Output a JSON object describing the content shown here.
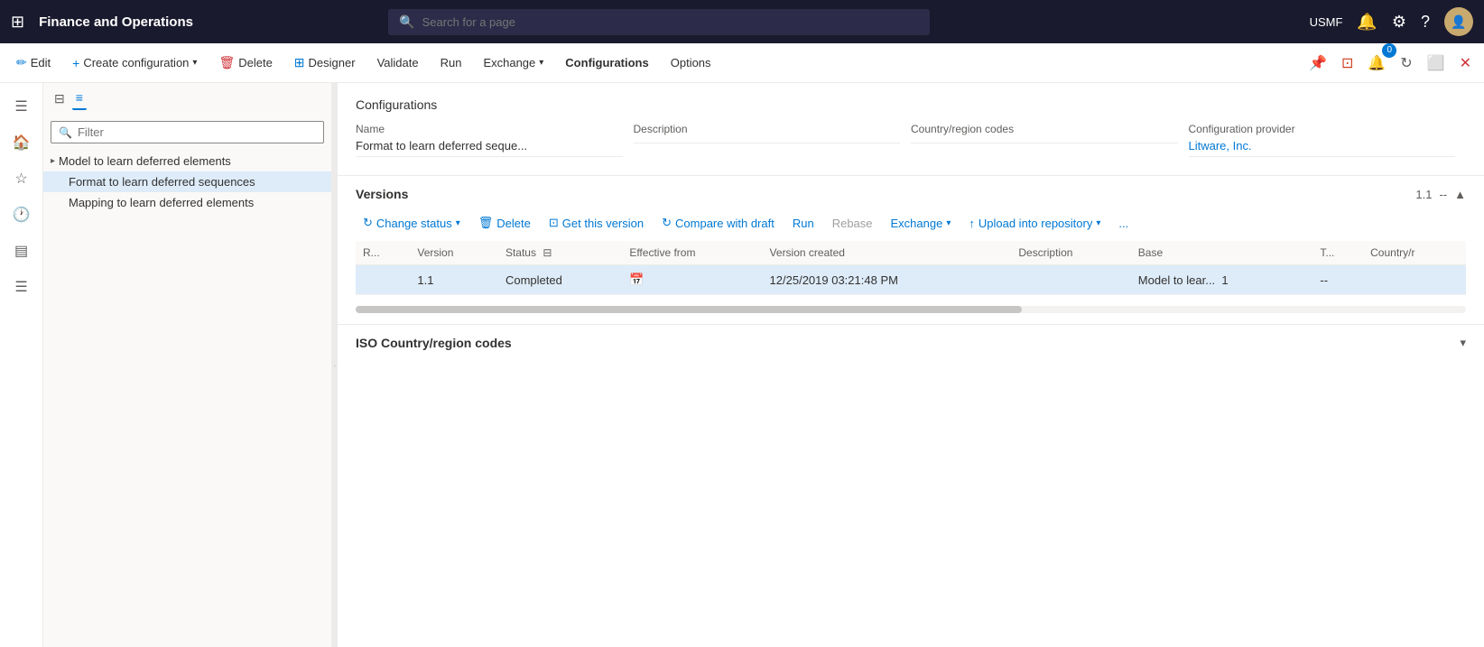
{
  "app": {
    "title": "Finance and Operations",
    "user": "USMF",
    "search_placeholder": "Search for a page",
    "notification_count": "0"
  },
  "command_bar": {
    "edit_label": "Edit",
    "create_config_label": "Create configuration",
    "delete_label": "Delete",
    "designer_label": "Designer",
    "validate_label": "Validate",
    "run_label": "Run",
    "exchange_label": "Exchange",
    "configurations_label": "Configurations",
    "options_label": "Options"
  },
  "tree": {
    "filter_placeholder": "Filter",
    "root_item": "Model to learn deferred elements",
    "items": [
      {
        "label": "Format to learn deferred sequences",
        "selected": true
      },
      {
        "label": "Mapping to learn deferred elements",
        "selected": false
      }
    ]
  },
  "config_panel": {
    "section_title": "Configurations",
    "fields": {
      "name_label": "Name",
      "name_value": "Format to learn deferred seque...",
      "description_label": "Description",
      "description_value": "",
      "country_label": "Country/region codes",
      "country_value": "",
      "provider_label": "Configuration provider",
      "provider_value": "Litware, Inc."
    }
  },
  "versions": {
    "title": "Versions",
    "version_number": "1.1",
    "separator": "--",
    "toolbar": {
      "change_status_label": "Change status",
      "delete_label": "Delete",
      "get_this_version_label": "Get this version",
      "compare_with_draft_label": "Compare with draft",
      "run_label": "Run",
      "rebase_label": "Rebase",
      "exchange_label": "Exchange",
      "upload_label": "Upload into repository",
      "more_label": "..."
    },
    "table": {
      "columns": [
        "R...",
        "Version",
        "Status",
        "Effective from",
        "Version created",
        "Description",
        "Base",
        "T...",
        "Country/r"
      ],
      "rows": [
        {
          "r": "",
          "version": "1.1",
          "status": "Completed",
          "effective_from": "",
          "version_created": "12/25/2019 03:21:48 PM",
          "description": "",
          "base": "Model to lear...",
          "base_link": "1",
          "t": "--",
          "country": ""
        }
      ]
    }
  },
  "iso_section": {
    "title": "ISO Country/region codes"
  }
}
